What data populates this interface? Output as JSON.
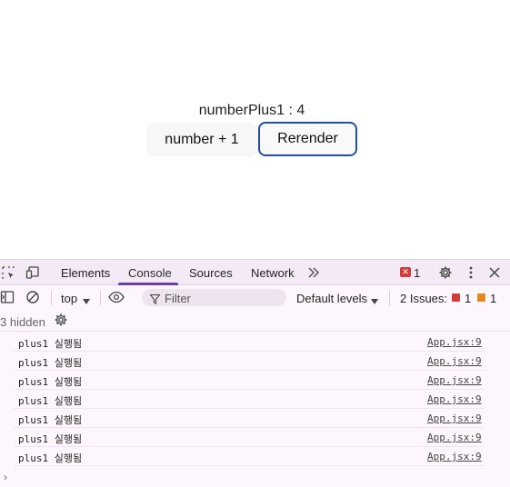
{
  "app": {
    "counter_text": "numberPlus1 : 4",
    "plus_button_label": "number + 1",
    "rerender_button_label": "Rerender"
  },
  "devtools": {
    "tabs": [
      "Elements",
      "Console",
      "Sources",
      "Network"
    ],
    "active_tab": "Console",
    "more_tabs_icon": "chevron-double-right-icon",
    "error_count": "1",
    "toolbar": {
      "context": "top",
      "filter_placeholder": "Filter",
      "levels": "Default levels",
      "issues_label": "2 Issues:",
      "issues_errors": "1",
      "issues_warnings": "1"
    },
    "hidden_label": "3 hidden",
    "logs": [
      {
        "message": "plus1 실행됨",
        "source": "App.jsx:9"
      },
      {
        "message": "plus1 실행됨",
        "source": "App.jsx:9"
      },
      {
        "message": "plus1 실행됨",
        "source": "App.jsx:9"
      },
      {
        "message": "plus1 실행됨",
        "source": "App.jsx:9"
      },
      {
        "message": "plus1 실행됨",
        "source": "App.jsx:9"
      },
      {
        "message": "plus1 실행됨",
        "source": "App.jsx:9"
      },
      {
        "message": "plus1 실행됨",
        "source": "App.jsx:9"
      }
    ],
    "prompt_symbol": "›"
  },
  "colors": {
    "accent": "#6b3fa0",
    "button_border": "#1f4fa3",
    "error": "#d33b3b",
    "warning": "#e8851c"
  }
}
